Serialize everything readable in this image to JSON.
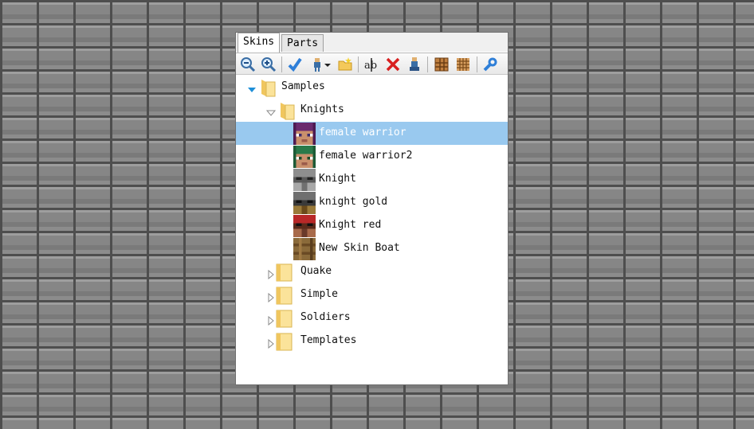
{
  "tabs": [
    {
      "label": "Skins"
    },
    {
      "label": "Parts"
    }
  ],
  "toolbar": {
    "icons": [
      "zoom-out-icon",
      "zoom-in-icon",
      "apply-icon",
      "import-icon",
      "new-folder-icon",
      "rename-icon",
      "delete-icon",
      "clone-icon",
      "grid-icon",
      "grid-2-icon",
      "link-icon"
    ]
  },
  "tree": {
    "root": {
      "label": "Samples"
    },
    "knights": {
      "label": "Knights",
      "items": [
        {
          "label": "female warrior"
        },
        {
          "label": "female warrior2"
        },
        {
          "label": "Knight"
        },
        {
          "label": "knight gold"
        },
        {
          "label": "Knight red"
        },
        {
          "label": "New Skin Boat"
        }
      ]
    },
    "folders": [
      {
        "label": "Quake"
      },
      {
        "label": "Simple"
      },
      {
        "label": "Soldiers"
      },
      {
        "label": "Templates"
      }
    ]
  },
  "colors": {
    "selection": "#99c9ef",
    "folder": "#f4d470",
    "background_stone": "#8a8a8a"
  }
}
